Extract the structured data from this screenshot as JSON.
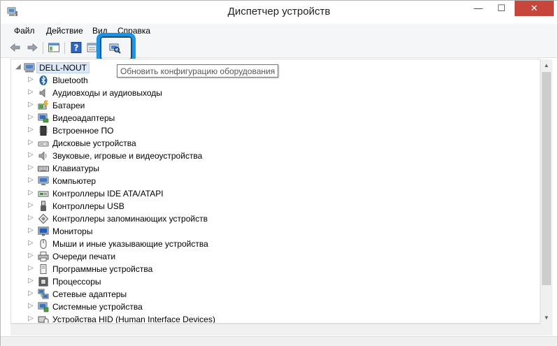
{
  "window": {
    "title": "Диспетчер устройств",
    "controls": {
      "minimize": "—",
      "maximize": "☐",
      "close": "✕"
    }
  },
  "menu": {
    "items": [
      "Файл",
      "Действие",
      "Вид",
      "Справка"
    ]
  },
  "toolbar": {
    "buttons": [
      "back-icon",
      "forward-icon",
      "show-hide-console-tree-icon",
      "help-icon",
      "properties-icon",
      "scan-hardware-changes-icon"
    ],
    "highlight_color": "#1795e6"
  },
  "tooltip": {
    "text": "Обновить конфигурацию оборудования"
  },
  "tree": {
    "root": {
      "label": "DELL-NOUT",
      "icon": "computer-icon"
    },
    "items": [
      {
        "label": "Bluetooth",
        "icon": "bluetooth-icon"
      },
      {
        "label": "Аудиовходы и аудиовыходы",
        "icon": "audio-io-icon"
      },
      {
        "label": "Батареи",
        "icon": "battery-icon"
      },
      {
        "label": "Видеоадаптеры",
        "icon": "display-adapter-icon"
      },
      {
        "label": "Встроенное ПО",
        "icon": "firmware-icon"
      },
      {
        "label": "Дисковые устройства",
        "icon": "disk-drive-icon"
      },
      {
        "label": "Звуковые, игровые и видеоустройства",
        "icon": "sound-icon"
      },
      {
        "label": "Клавиатуры",
        "icon": "keyboard-icon"
      },
      {
        "label": "Компьютер",
        "icon": "computer-icon"
      },
      {
        "label": "Контроллеры IDE ATA/ATAPI",
        "icon": "ide-controller-icon"
      },
      {
        "label": "Контроллеры USB",
        "icon": "usb-icon"
      },
      {
        "label": "Контроллеры запоминающих устройств",
        "icon": "storage-controller-icon"
      },
      {
        "label": "Мониторы",
        "icon": "monitor-icon"
      },
      {
        "label": "Мыши и иные указывающие устройства",
        "icon": "mouse-icon"
      },
      {
        "label": "Очереди печати",
        "icon": "printer-icon"
      },
      {
        "label": "Программные устройства",
        "icon": "software-device-icon"
      },
      {
        "label": "Процессоры",
        "icon": "processor-icon"
      },
      {
        "label": "Сетевые адаптеры",
        "icon": "network-adapter-icon"
      },
      {
        "label": "Системные устройства",
        "icon": "system-device-icon"
      },
      {
        "label": "Устройства HID (Human Interface Devices)",
        "icon": "hid-icon"
      }
    ]
  }
}
